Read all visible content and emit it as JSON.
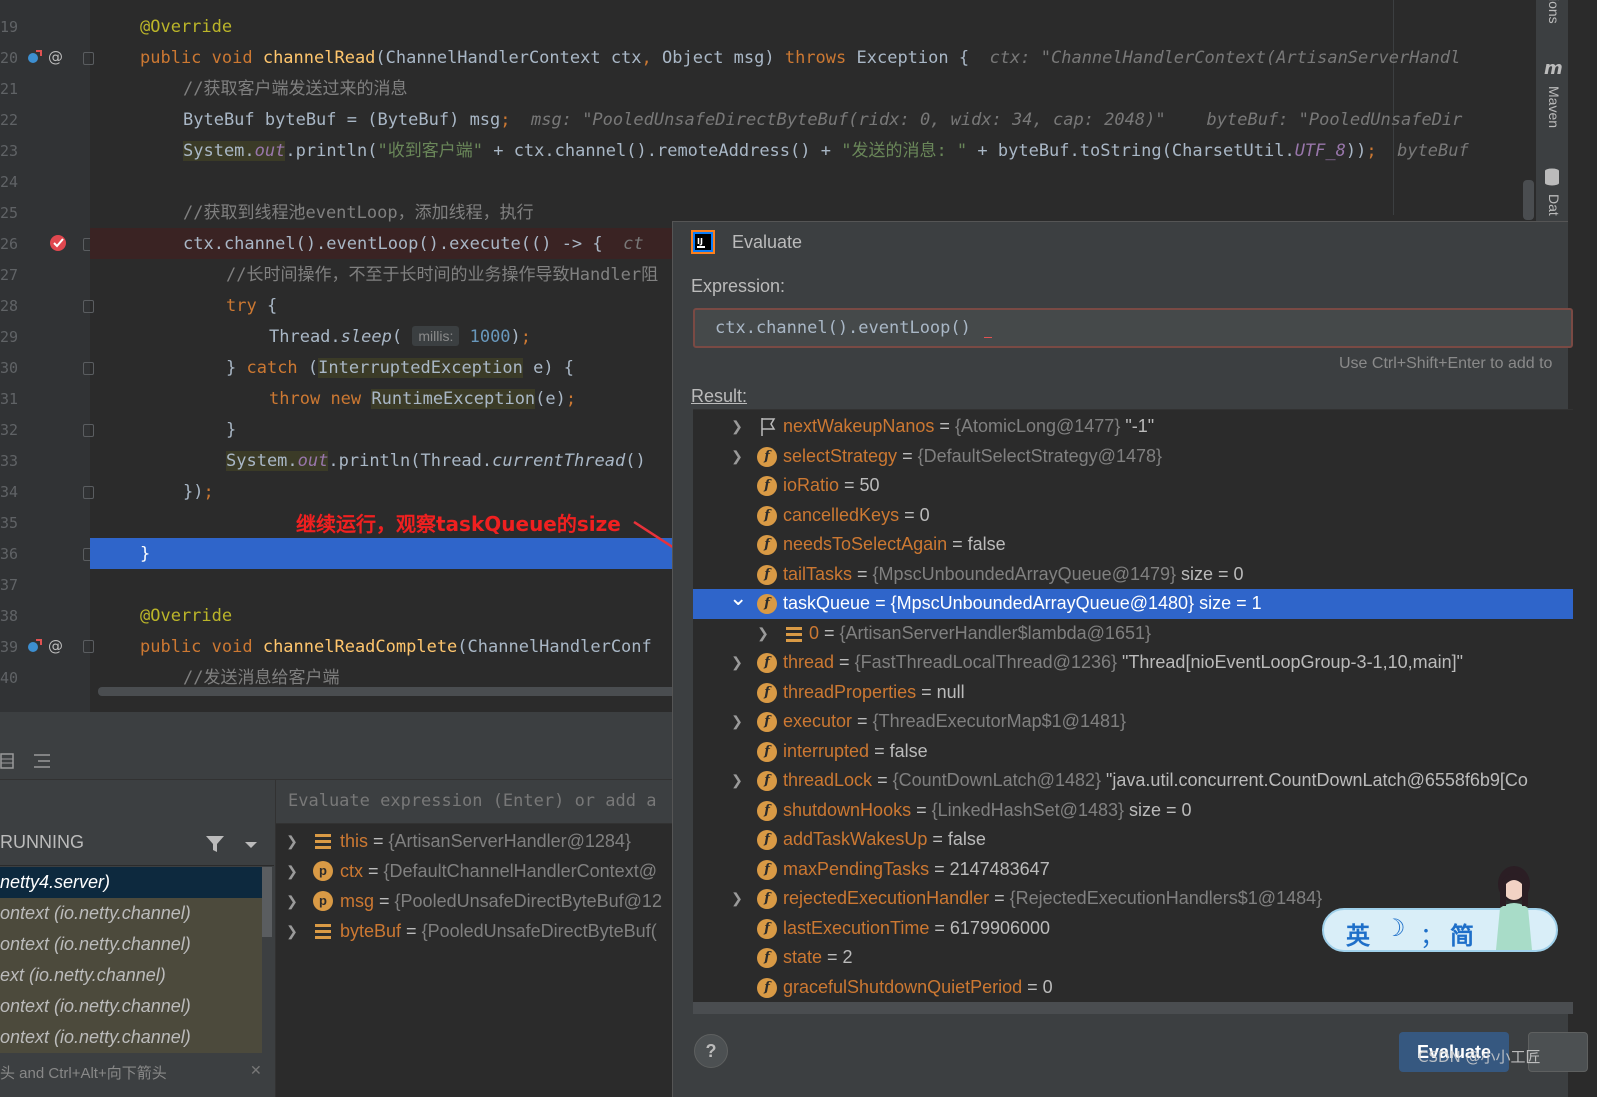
{
  "editor": {
    "line_numbers": [
      "19",
      "20",
      "21",
      "22",
      "23",
      "24",
      "25",
      "26",
      "27",
      "28",
      "29",
      "30",
      "31",
      "32",
      "33",
      "34",
      "35",
      "36",
      "37",
      "38",
      "39",
      "40"
    ],
    "lines": {
      "l19": {
        "ann": "@Override"
      },
      "l20": {
        "kw1": "public void ",
        "fn": "channelRead",
        "p1": "(ChannelHandlerContext ctx",
        "comma": ",",
        "p2": " Object msg) ",
        "kw2": "throws ",
        "p3": "Exception {",
        "hint": "ctx: \"ChannelHandlerContext(ArtisanServerHandl"
      },
      "l21": {
        "cm": "//获取客户端发送过来的消息"
      },
      "l22": {
        "code": "ByteBuf byteBuf = (ByteBuf) msg",
        "semi": ";",
        "hint1": "msg: \"PooledUnsafeDirectByteBuf(ridx: 0, widx: 34, cap: 2048)\"",
        "hint2": "byteBuf: \"PooledUnsafeDir"
      },
      "l23": {
        "sys": "System.",
        "out": "out",
        "a": ".println(",
        "s1": "\"收到客户端\"",
        "b": " + ctx.channel().remoteAddress() + ",
        "s2": "\"发送的消息: \"",
        "c": " + byteBuf.toString(CharsetUtil.",
        "utf": "UTF_8",
        "d": "))",
        "semi": ";",
        "hint": "byteBuf"
      },
      "l25": {
        "cm": "//获取到线程池eventLoop，添加线程，执行"
      },
      "l26": {
        "code": "ctx.channel().eventLoop().execute(() -> {",
        "hint": "ct"
      },
      "l27": {
        "cm": "//长时间操作，不至于长时间的业务操作导致Handler阻"
      },
      "l28": {
        "kw": "try",
        "rest": " {"
      },
      "l29": {
        "a": "Thread.",
        "sleep": "sleep",
        "b": "(",
        "chip": "millis:",
        "num": "1000",
        "c": ")",
        "semi": ";"
      },
      "l30": {
        "a": "} ",
        "kw": "catch",
        "b": " (",
        "ex": "InterruptedException",
        "c": " e) {"
      },
      "l31": {
        "kw1": "throw",
        "sp": " ",
        "kw2": "new",
        "sp2": " ",
        "ex": "RuntimeException",
        "b": "(e)",
        "semi": ";"
      },
      "l32": {
        "code": "}"
      },
      "l33": {
        "sys": "System.",
        "out": "out",
        "a": ".println(Thread.",
        "ct": "currentThread",
        "b": "()"
      },
      "l34": {
        "code": "})",
        "semi": ";"
      },
      "l36": {
        "code": "}"
      },
      "l38": {
        "ann": "@Override"
      },
      "l39": {
        "kw1": "public void ",
        "fn": "channelReadComplete",
        "p1": "(ChannelHandlerConf"
      },
      "l40": {
        "cm": "//发送消息给客户端"
      }
    },
    "annotation": "继续运行，观察taskQueue的size"
  },
  "right_strip": {
    "tab1": "ions",
    "tab2": "Maven",
    "tab3": "Dat"
  },
  "debug": {
    "running_label": "RUNNING",
    "frames": [
      "netty4.server)",
      "ontext (io.netty.channel)",
      "ontext (io.netty.channel)",
      "ext (io.netty.channel)",
      "ontext (io.netty.channel)",
      "ontext (io.netty.channel)"
    ],
    "bottom_hint": "头 and Ctrl+Alt+向下箭头",
    "eval_placeholder": "Evaluate expression (Enter) or add a",
    "vars": [
      {
        "name": "this",
        "value": "{ArtisanServerHandler@1284}",
        "icon": "list-icon"
      },
      {
        "name": "ctx",
        "value": "{DefaultChannelHandlerContext@",
        "icon": "param-icon"
      },
      {
        "name": "msg",
        "value": "{PooledUnsafeDirectByteBuf@12",
        "icon": "param-icon"
      },
      {
        "name": "byteBuf",
        "value": "{PooledUnsafeDirectByteBuf(",
        "icon": "list-icon"
      }
    ]
  },
  "evaluate": {
    "title": "Evaluate",
    "expression_label": "Expression:",
    "expression": "ctx.channel().eventLoop()",
    "hint": "Use Ctrl+Shift+Enter to add to",
    "result_label": "Result:",
    "rows": [
      {
        "name": "nextWakeupNanos",
        "ref": "{AtomicLong@1477}",
        "tail": " \"-1\"",
        "expandable": true
      },
      {
        "name": "selectStrategy",
        "ref": "{DefaultSelectStrategy@1478}",
        "tail": "",
        "expandable": true
      },
      {
        "name": "ioRatio",
        "ref": "",
        "tail": "50",
        "expandable": false
      },
      {
        "name": "cancelledKeys",
        "ref": "",
        "tail": "0",
        "expandable": false
      },
      {
        "name": "needsToSelectAgain",
        "ref": "",
        "tail": "false",
        "expandable": false
      },
      {
        "name": "tailTasks",
        "ref": "{MpscUnboundedArrayQueue@1479}",
        "tail": "  size = 0",
        "expandable": false
      },
      {
        "name": "taskQueue",
        "ref": "{MpscUnboundedArrayQueue@1480}",
        "tail": "  size = 1",
        "expandable": true
      },
      {
        "name": "0",
        "ref": "{ArtisanServerHandler$lambda@1651}",
        "tail": "",
        "expandable": true
      },
      {
        "name": "thread",
        "ref": "{FastThreadLocalThread@1236}",
        "tail": " \"Thread[nioEventLoopGroup-3-1,10,main]\"",
        "expandable": true
      },
      {
        "name": "threadProperties",
        "ref": "",
        "tail": "null",
        "expandable": false
      },
      {
        "name": "executor",
        "ref": "{ThreadExecutorMap$1@1481}",
        "tail": "",
        "expandable": true
      },
      {
        "name": "interrupted",
        "ref": "",
        "tail": "false",
        "expandable": false
      },
      {
        "name": "threadLock",
        "ref": "{CountDownLatch@1482}",
        "tail": " \"java.util.concurrent.CountDownLatch@6558f6b9[Co",
        "expandable": true
      },
      {
        "name": "shutdownHooks",
        "ref": "{LinkedHashSet@1483}",
        "tail": "  size = 0",
        "expandable": false
      },
      {
        "name": "addTaskWakesUp",
        "ref": "",
        "tail": "false",
        "expandable": false
      },
      {
        "name": "maxPendingTasks",
        "ref": "",
        "tail": "2147483647",
        "expandable": false
      },
      {
        "name": "rejectedExecutionHandler",
        "ref": "{RejectedExecutionHandlers$1@1484}",
        "tail": "",
        "expandable": true
      },
      {
        "name": "lastExecutionTime",
        "ref": "",
        "tail": "6179906000",
        "expandable": false
      },
      {
        "name": "state",
        "ref": "",
        "tail": "2",
        "expandable": false
      },
      {
        "name": "gracefulShutdownQuietPeriod",
        "ref": "",
        "tail": "0",
        "expandable": false
      }
    ],
    "evaluate_button": "Evaluate",
    "help": "?"
  },
  "ime": {
    "lang": "英",
    "punct": "；",
    "mode": "简"
  },
  "watermark": "CSDN @小小工匠"
}
